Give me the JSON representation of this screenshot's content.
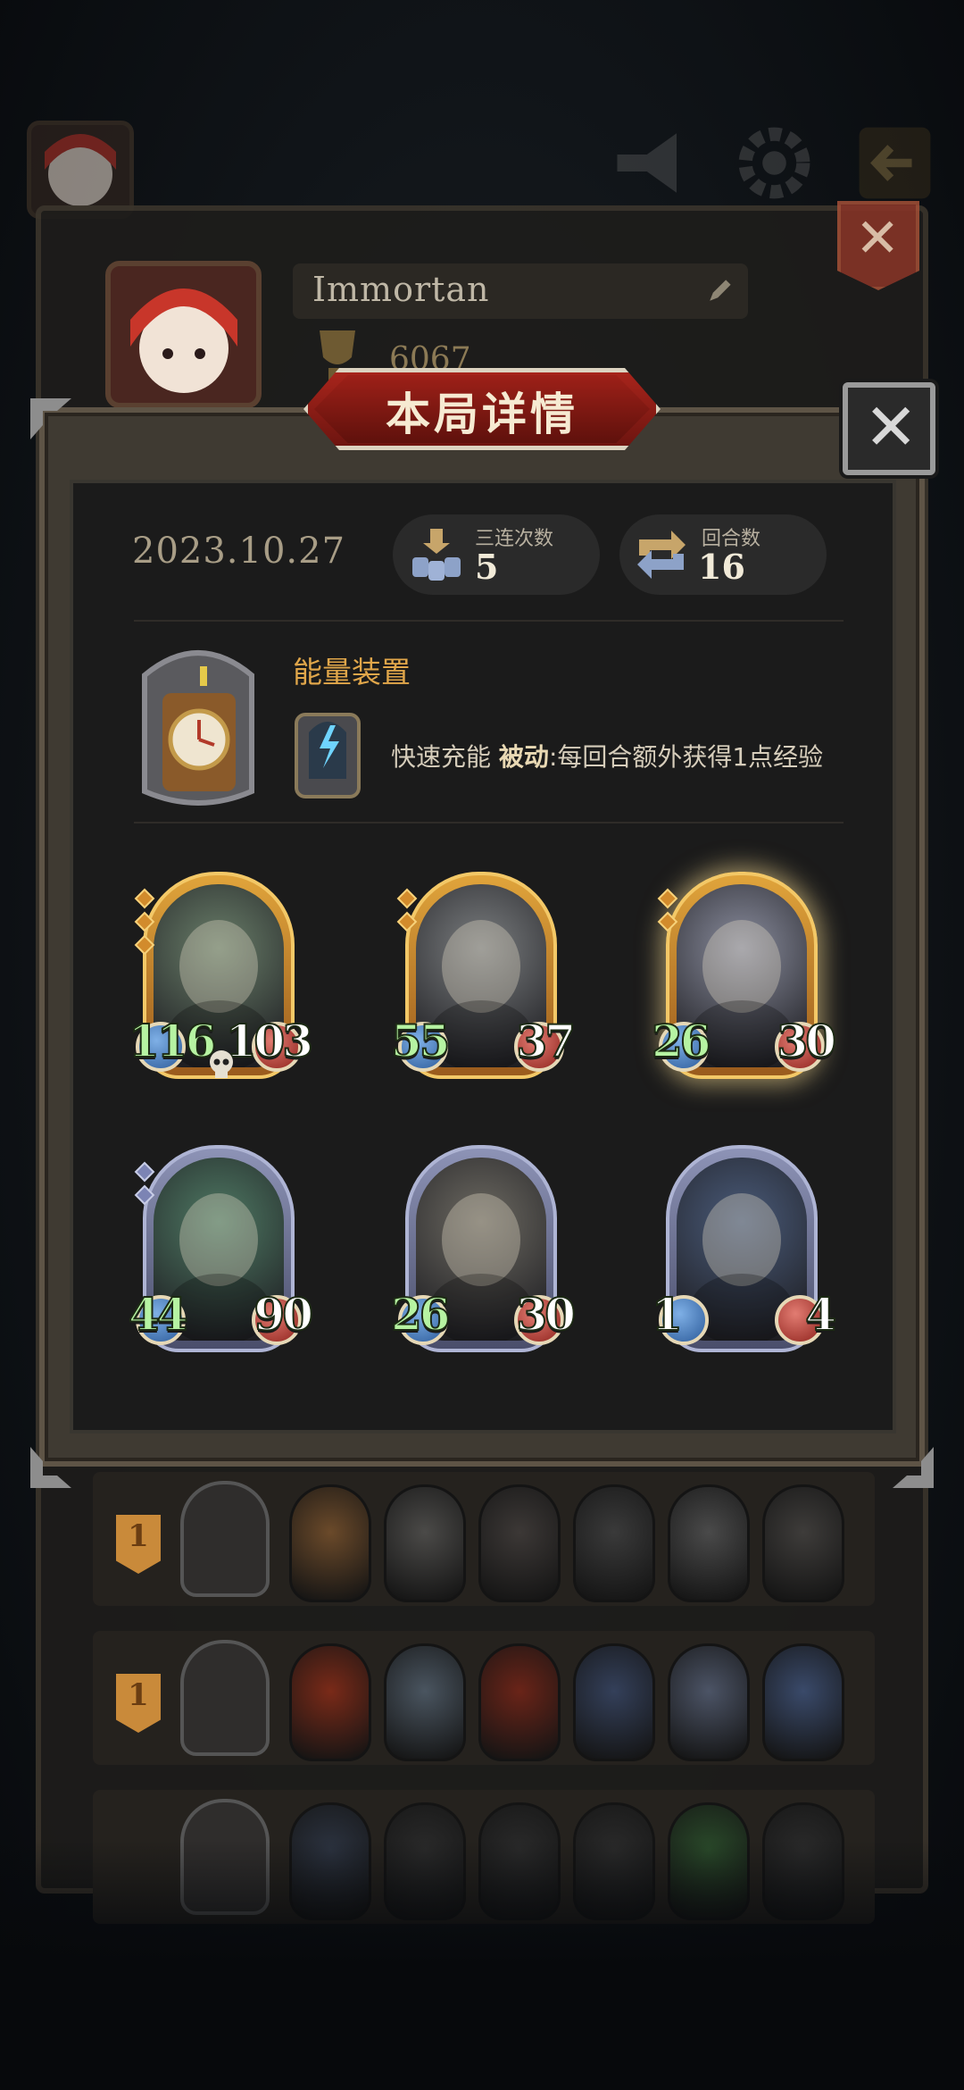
{
  "background": {
    "player_name": "Immortan",
    "player_score": "6067"
  },
  "dialog": {
    "title": "本局详情",
    "date": "2023.10.27",
    "stats": [
      {
        "label": "三连次数",
        "value": "5",
        "icon": "triple-merge-icon"
      },
      {
        "label": "回合数",
        "value": "16",
        "icon": "round-arrows-icon"
      }
    ],
    "device": {
      "name": "能量装置",
      "skill_name": "快速充能",
      "skill_type": "被动",
      "skill_desc": ":每回合额外获得1点经验"
    },
    "units": [
      {
        "name": "golden-dragon",
        "attack": "116",
        "health": "103",
        "tier": "gold",
        "pips": 3,
        "attack_white": false,
        "skull": true,
        "glow": false,
        "art": "#6a7f6a"
      },
      {
        "name": "horned-demon",
        "attack": "55",
        "health": "37",
        "tier": "gold",
        "pips": 2,
        "attack_white": false,
        "skull": false,
        "glow": false,
        "art": "#7b7e80"
      },
      {
        "name": "dragon-knight",
        "attack": "26",
        "health": "30",
        "tier": "gold",
        "pips": 2,
        "attack_white": false,
        "skull": false,
        "glow": true,
        "art": "#8a8d9e"
      },
      {
        "name": "sea-serpent",
        "attack": "44",
        "health": "90",
        "tier": "silver",
        "pips": 2,
        "attack_white": false,
        "skull": false,
        "glow": false,
        "art": "#4f7a64"
      },
      {
        "name": "cyborg-scientist",
        "attack": "26",
        "health": "30",
        "tier": "silver",
        "pips": 0,
        "attack_white": false,
        "skull": false,
        "glow": false,
        "art": "#6d6a62"
      },
      {
        "name": "sea-witch",
        "attack": "1",
        "health": "4",
        "tier": "silver",
        "pips": 0,
        "attack_white": true,
        "skull": false,
        "glow": false,
        "art": "#4a5b7a"
      }
    ]
  },
  "lineups": [
    {
      "rank": "1",
      "units": [
        "#6b4a2a",
        "#4b4a48",
        "#3c3836",
        "#3a3a3a",
        "#4a4a4a",
        "#3e3c3a"
      ]
    },
    {
      "rank": "1",
      "units": [
        "#7a2a18",
        "#4a5560",
        "#6a2418",
        "#34405a",
        "#4c5466",
        "#3a4a6a"
      ]
    },
    {
      "rank": "",
      "units": [
        "#2c3340",
        "#2a2a2a",
        "#2a2a2a",
        "#2a2a2a",
        "#2a4a2a",
        "#2a2a2a"
      ]
    }
  ],
  "colors": {
    "accent_gold": "#e0a64a",
    "stat_green": "#b6f3a2",
    "title_red": "#9d2018"
  }
}
